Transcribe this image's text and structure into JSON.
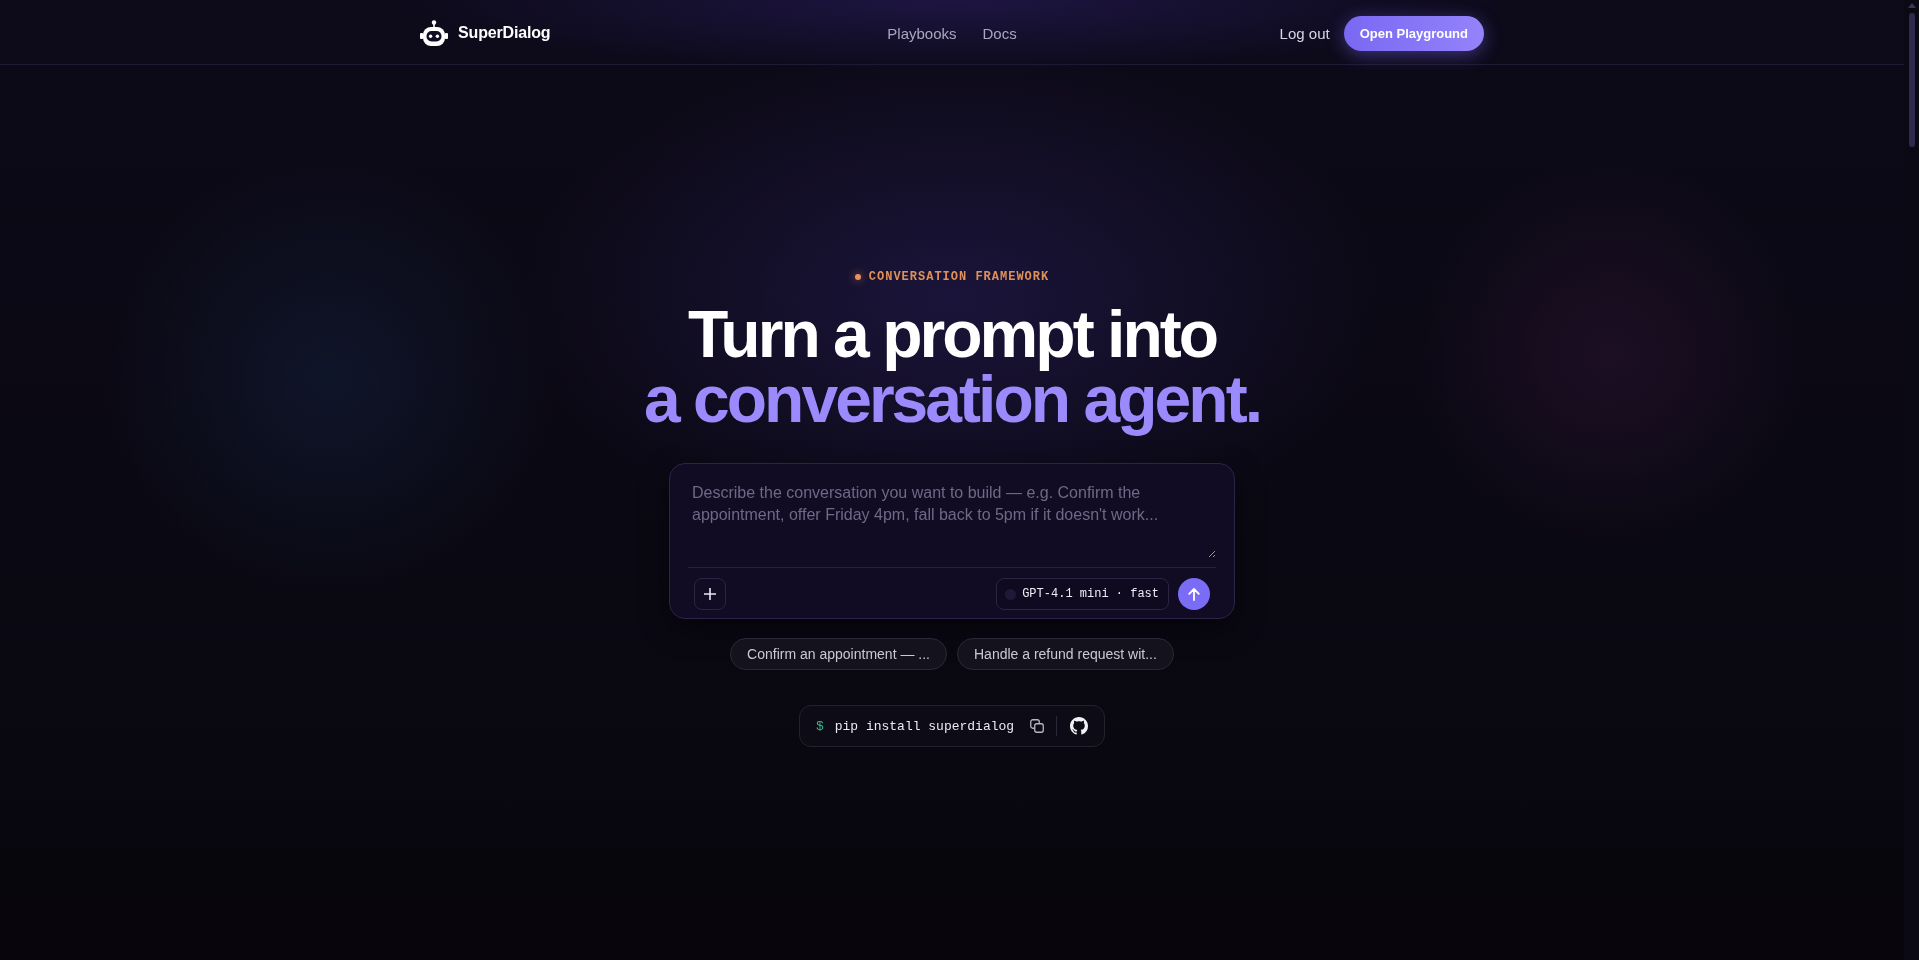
{
  "nav": {
    "brand": "SuperDialog",
    "links": [
      {
        "label": "Playbooks"
      },
      {
        "label": "Docs"
      }
    ],
    "log_out": "Log out",
    "cta": "Open Playground"
  },
  "hero": {
    "eyebrow": "CONVERSATION FRAMEWORK",
    "title_line_1": "Turn a prompt into",
    "title_line_2": "a conversation agent."
  },
  "composer": {
    "placeholder": "Describe the conversation you want to build — e.g. Confirm the appointment, offer Friday 4pm, fall back to 5pm if it doesn't work...",
    "model": "GPT-4.1 mini · fast"
  },
  "suggestions": [
    {
      "label": "Confirm an appointment — ..."
    },
    {
      "label": "Handle a refund request wit..."
    }
  ],
  "install": {
    "prompt": "$",
    "command": "pip install superdialog"
  }
}
